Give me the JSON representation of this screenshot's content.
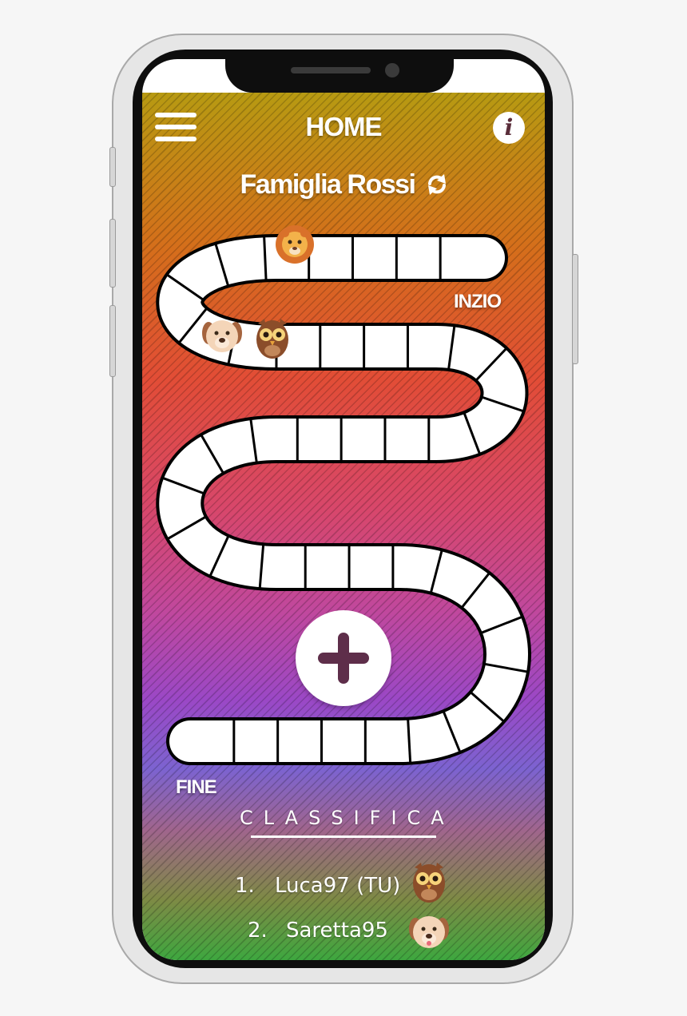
{
  "header": {
    "title": "HOME",
    "info_label": "i"
  },
  "group": {
    "name": "Famiglia Rossi"
  },
  "board": {
    "start_label": "INZIO",
    "end_label": "FINE",
    "add_label": "+"
  },
  "leaderboard": {
    "title": "CLASSIFICA",
    "entries": [
      {
        "rank": "1.",
        "name": "Luca97 (TU)",
        "avatar": "owl-icon"
      },
      {
        "rank": "2.",
        "name": "Saretta95",
        "avatar": "dog-icon"
      }
    ]
  },
  "tokens": [
    "lion-icon",
    "dog-icon",
    "owl-icon"
  ],
  "colors": {
    "accent": "#5e2e4a",
    "path": "#ffffff",
    "outline": "#000000"
  }
}
